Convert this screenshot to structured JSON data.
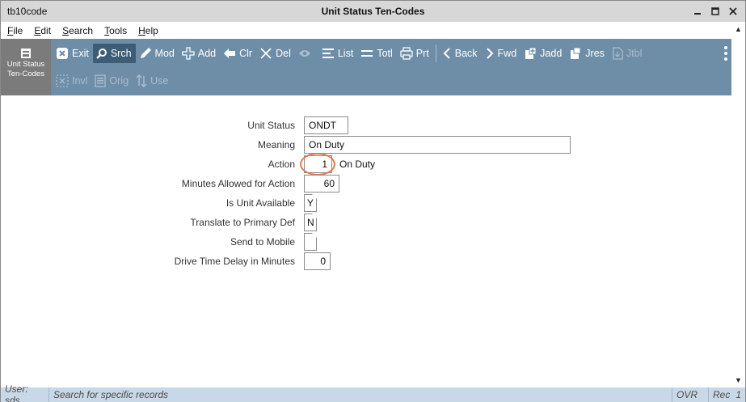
{
  "window": {
    "app_name": "tb10code",
    "title": "Unit Status Ten-Codes"
  },
  "menu": {
    "items": [
      {
        "label": "File",
        "mnemonic": "F",
        "rest": "ile"
      },
      {
        "label": "Edit",
        "mnemonic": "E",
        "rest": "dit"
      },
      {
        "label": "Search",
        "mnemonic": "S",
        "rest": "earch"
      },
      {
        "label": "Tools",
        "mnemonic": "T",
        "rest": "ools"
      },
      {
        "label": "Help",
        "mnemonic": "H",
        "rest": "elp"
      }
    ]
  },
  "form_tile": {
    "line1": "Unit Status",
    "line2": "Ten-Codes"
  },
  "toolbar": {
    "exit": "Exit",
    "srch": "Srch",
    "mod": "Mod",
    "add": "Add",
    "clr": "Clr",
    "del": "Del",
    "list": "List",
    "totl": "Totl",
    "prt": "Prt",
    "back": "Back",
    "fwd": "Fwd",
    "jadd": "Jadd",
    "jres": "Jres",
    "jtbl": "Jtbl",
    "invl": "Invl",
    "orig": "Orig",
    "use": "Use"
  },
  "form": {
    "unit_status": {
      "label": "Unit Status",
      "value": "ONDT"
    },
    "meaning": {
      "label": "Meaning",
      "value": "On Duty"
    },
    "action": {
      "label": "Action",
      "value": "1",
      "description": "On Duty"
    },
    "minutes_allowed": {
      "label": "Minutes Allowed for Action",
      "value": "60"
    },
    "is_unit_available": {
      "label": "Is Unit Available",
      "value": "Y"
    },
    "translate_primary": {
      "label": "Translate to Primary Def",
      "value": "N"
    },
    "send_to_mobile": {
      "label": "Send to Mobile",
      "value": ""
    },
    "drive_time_delay": {
      "label": "Drive Time Delay in Minutes",
      "value": "0"
    }
  },
  "status_bar": {
    "user": "User: sds",
    "message": "Search for specific records",
    "mode": "OVR",
    "rec_label": "Rec",
    "rec_value": "1"
  },
  "colors": {
    "toolbar": "#6e8ea8",
    "active_button": "#3d5d76",
    "form_tile": "#7b7b7b",
    "status_bar": "#c9d8e6",
    "highlight": "#e07850"
  }
}
